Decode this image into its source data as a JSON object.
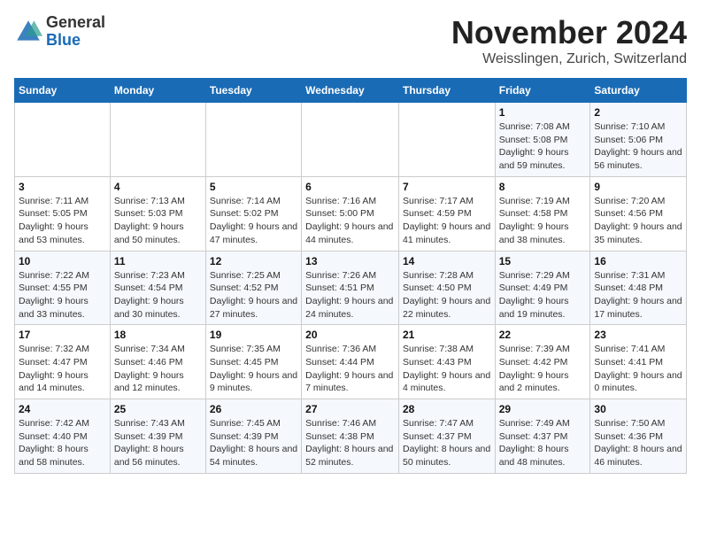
{
  "logo": {
    "general": "General",
    "blue": "Blue"
  },
  "header": {
    "month": "November 2024",
    "location": "Weisslingen, Zurich, Switzerland"
  },
  "weekdays": [
    "Sunday",
    "Monday",
    "Tuesday",
    "Wednesday",
    "Thursday",
    "Friday",
    "Saturday"
  ],
  "weeks": [
    [
      {
        "day": "",
        "info": ""
      },
      {
        "day": "",
        "info": ""
      },
      {
        "day": "",
        "info": ""
      },
      {
        "day": "",
        "info": ""
      },
      {
        "day": "",
        "info": ""
      },
      {
        "day": "1",
        "info": "Sunrise: 7:08 AM\nSunset: 5:08 PM\nDaylight: 9 hours and 59 minutes."
      },
      {
        "day": "2",
        "info": "Sunrise: 7:10 AM\nSunset: 5:06 PM\nDaylight: 9 hours and 56 minutes."
      }
    ],
    [
      {
        "day": "3",
        "info": "Sunrise: 7:11 AM\nSunset: 5:05 PM\nDaylight: 9 hours and 53 minutes."
      },
      {
        "day": "4",
        "info": "Sunrise: 7:13 AM\nSunset: 5:03 PM\nDaylight: 9 hours and 50 minutes."
      },
      {
        "day": "5",
        "info": "Sunrise: 7:14 AM\nSunset: 5:02 PM\nDaylight: 9 hours and 47 minutes."
      },
      {
        "day": "6",
        "info": "Sunrise: 7:16 AM\nSunset: 5:00 PM\nDaylight: 9 hours and 44 minutes."
      },
      {
        "day": "7",
        "info": "Sunrise: 7:17 AM\nSunset: 4:59 PM\nDaylight: 9 hours and 41 minutes."
      },
      {
        "day": "8",
        "info": "Sunrise: 7:19 AM\nSunset: 4:58 PM\nDaylight: 9 hours and 38 minutes."
      },
      {
        "day": "9",
        "info": "Sunrise: 7:20 AM\nSunset: 4:56 PM\nDaylight: 9 hours and 35 minutes."
      }
    ],
    [
      {
        "day": "10",
        "info": "Sunrise: 7:22 AM\nSunset: 4:55 PM\nDaylight: 9 hours and 33 minutes."
      },
      {
        "day": "11",
        "info": "Sunrise: 7:23 AM\nSunset: 4:54 PM\nDaylight: 9 hours and 30 minutes."
      },
      {
        "day": "12",
        "info": "Sunrise: 7:25 AM\nSunset: 4:52 PM\nDaylight: 9 hours and 27 minutes."
      },
      {
        "day": "13",
        "info": "Sunrise: 7:26 AM\nSunset: 4:51 PM\nDaylight: 9 hours and 24 minutes."
      },
      {
        "day": "14",
        "info": "Sunrise: 7:28 AM\nSunset: 4:50 PM\nDaylight: 9 hours and 22 minutes."
      },
      {
        "day": "15",
        "info": "Sunrise: 7:29 AM\nSunset: 4:49 PM\nDaylight: 9 hours and 19 minutes."
      },
      {
        "day": "16",
        "info": "Sunrise: 7:31 AM\nSunset: 4:48 PM\nDaylight: 9 hours and 17 minutes."
      }
    ],
    [
      {
        "day": "17",
        "info": "Sunrise: 7:32 AM\nSunset: 4:47 PM\nDaylight: 9 hours and 14 minutes."
      },
      {
        "day": "18",
        "info": "Sunrise: 7:34 AM\nSunset: 4:46 PM\nDaylight: 9 hours and 12 minutes."
      },
      {
        "day": "19",
        "info": "Sunrise: 7:35 AM\nSunset: 4:45 PM\nDaylight: 9 hours and 9 minutes."
      },
      {
        "day": "20",
        "info": "Sunrise: 7:36 AM\nSunset: 4:44 PM\nDaylight: 9 hours and 7 minutes."
      },
      {
        "day": "21",
        "info": "Sunrise: 7:38 AM\nSunset: 4:43 PM\nDaylight: 9 hours and 4 minutes."
      },
      {
        "day": "22",
        "info": "Sunrise: 7:39 AM\nSunset: 4:42 PM\nDaylight: 9 hours and 2 minutes."
      },
      {
        "day": "23",
        "info": "Sunrise: 7:41 AM\nSunset: 4:41 PM\nDaylight: 9 hours and 0 minutes."
      }
    ],
    [
      {
        "day": "24",
        "info": "Sunrise: 7:42 AM\nSunset: 4:40 PM\nDaylight: 8 hours and 58 minutes."
      },
      {
        "day": "25",
        "info": "Sunrise: 7:43 AM\nSunset: 4:39 PM\nDaylight: 8 hours and 56 minutes."
      },
      {
        "day": "26",
        "info": "Sunrise: 7:45 AM\nSunset: 4:39 PM\nDaylight: 8 hours and 54 minutes."
      },
      {
        "day": "27",
        "info": "Sunrise: 7:46 AM\nSunset: 4:38 PM\nDaylight: 8 hours and 52 minutes."
      },
      {
        "day": "28",
        "info": "Sunrise: 7:47 AM\nSunset: 4:37 PM\nDaylight: 8 hours and 50 minutes."
      },
      {
        "day": "29",
        "info": "Sunrise: 7:49 AM\nSunset: 4:37 PM\nDaylight: 8 hours and 48 minutes."
      },
      {
        "day": "30",
        "info": "Sunrise: 7:50 AM\nSunset: 4:36 PM\nDaylight: 8 hours and 46 minutes."
      }
    ]
  ]
}
